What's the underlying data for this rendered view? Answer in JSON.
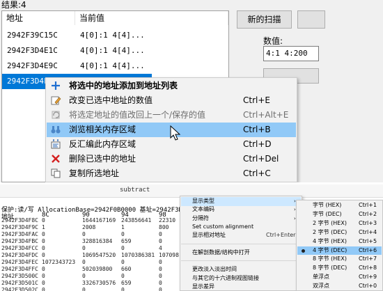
{
  "results": {
    "label": "结果:4",
    "columns": [
      "地址",
      "当前值"
    ],
    "rows": [
      {
        "address": "2942F39C15C",
        "value": "4[0]:1 4[4]..."
      },
      {
        "address": "2942F3D4E1C",
        "value": "4[0]:1 4[4]..."
      },
      {
        "address": "2942F3D4E9C",
        "value": "4[0]:1 4[4]..."
      },
      {
        "address": "2942F3D4F9C",
        "value": "4[0]:1 4[4]..."
      }
    ]
  },
  "scan": {
    "new_scan": "新的扫描",
    "value_label": "数值:",
    "value_text": "4:1 4:200"
  },
  "context_menu": {
    "items": [
      {
        "label": "将选中的地址添加到地址列表",
        "shortcut": "",
        "icon": "plus-icon"
      },
      {
        "label": "改变已选中地址的数值",
        "shortcut": "Ctrl+E",
        "icon": "edit-icon"
      },
      {
        "label": "将选定地址的值改回上一个/保存的值",
        "shortcut": "Ctrl+Alt+E",
        "icon": "undo-icon"
      },
      {
        "label": "浏览相关内存区域",
        "shortcut": "Ctrl+B",
        "icon": "binoculars-icon"
      },
      {
        "label": "反汇编此内存区域",
        "shortcut": "Ctrl+D",
        "icon": "disassemble-icon"
      },
      {
        "label": "删除已选中的地址",
        "shortcut": "Ctrl+Del",
        "icon": "delete-icon"
      },
      {
        "label": "复制所选地址",
        "shortcut": "Ctrl+C",
        "icon": "copy-icon"
      }
    ]
  },
  "memory": {
    "title": "subtract",
    "info": "保护:读/写  AllocationBase=2942F0B0000  基址=2942F3D0000",
    "header": {
      "col0": "地址",
      "col1": "8C",
      "col2": "90",
      "col3": "94",
      "col4": "98"
    },
    "rows": [
      {
        "addr": "2942F3D4F8C",
        "c1": "0",
        "c2": "1644167169",
        "c3": "243856641",
        "c4": "22310"
      },
      {
        "addr": "2942F3D4F9C",
        "c1": "1",
        "c2": "2008",
        "c3": "1",
        "c4": "800"
      },
      {
        "addr": "2942F3D4FAC",
        "c1": "0",
        "c2": "0",
        "c3": "0",
        "c4": "0"
      },
      {
        "addr": "2942F3D4FBC",
        "c1": "0",
        "c2": "328816384",
        "c3": "659",
        "c4": "0"
      },
      {
        "addr": "2942F3D4FCC",
        "c1": "0",
        "c2": "0",
        "c3": "0",
        "c4": "4"
      },
      {
        "addr": "2942F3D4FDC",
        "c1": "0",
        "c2": "1069547520",
        "c3": "1070386381",
        "c4": "107098"
      },
      {
        "addr": "2942F3D4FEC",
        "c1": "1072343723",
        "c2": "0",
        "c3": "0",
        "c4": "0"
      },
      {
        "addr": "2942F3D4FFC",
        "c1": "0",
        "c2": "502039800",
        "c3": "660",
        "c4": "0"
      },
      {
        "addr": "2942F3D500C",
        "c1": "0",
        "c2": "0",
        "c3": "0",
        "c4": "0"
      },
      {
        "addr": "2942F3D501C",
        "c1": "0",
        "c2": "3326730576",
        "c3": "659",
        "c4": "0"
      },
      {
        "addr": "2942F3D502C",
        "c1": "0",
        "c2": "0",
        "c3": "0",
        "c4": "0"
      }
    ]
  },
  "context_menu2": {
    "items": [
      {
        "label": "显示类型",
        "shortcut": "",
        "arrow": "›"
      },
      {
        "label": "文本编码",
        "shortcut": "",
        "arrow": "›"
      },
      {
        "label": "分隔符",
        "shortcut": "",
        "arrow": "›"
      },
      {
        "label": "Set custom alignment",
        "shortcut": "",
        "arrow": ""
      },
      {
        "label": "显示相对地址",
        "shortcut": "Ctrl+Enter",
        "arrow": ""
      },
      {
        "label": "",
        "shortcut": "",
        "arrow": ""
      },
      {
        "label": "在解剖数据/结构中打开",
        "shortcut": "",
        "arrow": ""
      },
      {
        "label": "",
        "shortcut": "",
        "arrow": ""
      },
      {
        "label": "更改淡入淡出时间",
        "shortcut": "",
        "arrow": ""
      },
      {
        "label": "与其它的十六进制视图链接",
        "shortcut": "",
        "arrow": ""
      },
      {
        "label": "显示差异",
        "shortcut": "",
        "arrow": ""
      }
    ]
  },
  "submenu2": {
    "items": [
      {
        "label": "字节 (HEX)",
        "shortcut": "Ctrl+1"
      },
      {
        "label": "字节 (DEC)",
        "shortcut": "Ctrl+2"
      },
      {
        "label": "2 字节 (HEX)",
        "shortcut": "Ctrl+3"
      },
      {
        "label": "2 字节 (DEC)",
        "shortcut": "Ctrl+4"
      },
      {
        "label": "4 字节 (HEX)",
        "shortcut": "Ctrl+5"
      },
      {
        "label": "4 字节 (DEC)",
        "shortcut": "Ctrl+6"
      },
      {
        "label": "8 字节 (HEX)",
        "shortcut": "Ctrl+7"
      },
      {
        "label": "8 字节 (DEC)",
        "shortcut": "Ctrl+8"
      },
      {
        "label": "单浮点",
        "shortcut": "Ctrl+9"
      },
      {
        "label": "双浮点",
        "shortcut": "Ctrl+0"
      }
    ]
  }
}
